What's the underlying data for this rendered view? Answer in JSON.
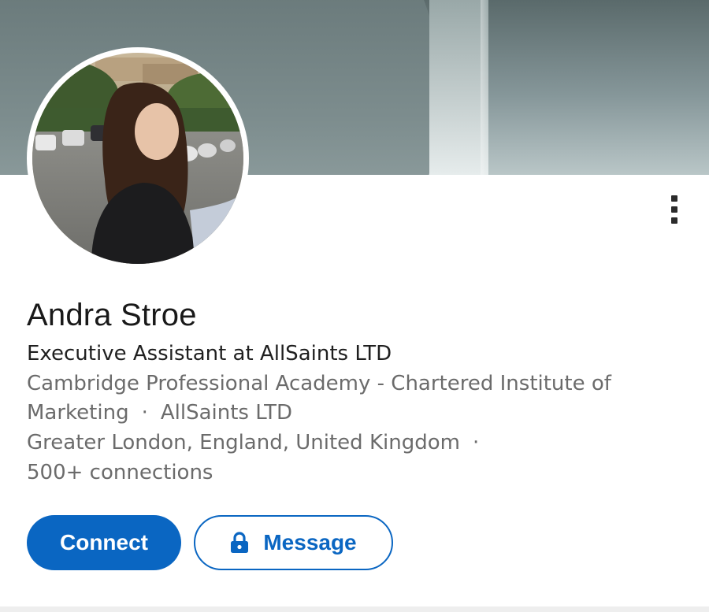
{
  "profile": {
    "name": "Andra Stroe",
    "headline": "Executive Assistant at AllSaints LTD",
    "education_line1": "Cambridge Professional Academy - Chartered Institute of",
    "education_line2": "Marketing",
    "current_company": "AllSaints LTD",
    "location": "Greater London, England, United Kingdom",
    "connections": "500+ connections",
    "separator": "·"
  },
  "actions": {
    "connect_label": "Connect",
    "message_label": "Message"
  },
  "icons": {
    "more": "more-vertical-icon",
    "lock": "lock-icon"
  },
  "colors": {
    "primary": "#0a66c2",
    "text_primary": "#191919",
    "text_secondary": "#6b6b6b"
  }
}
